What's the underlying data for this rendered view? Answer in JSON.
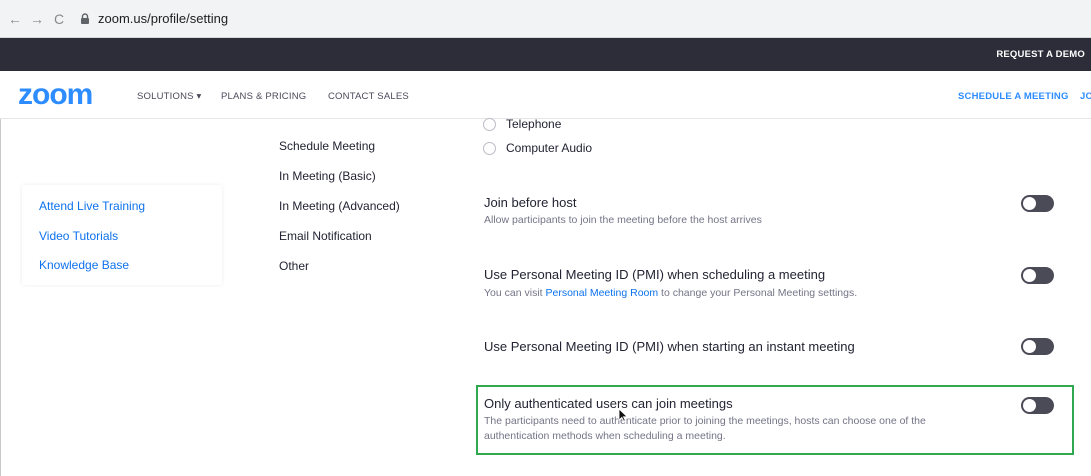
{
  "browser": {
    "back_glyph": "←",
    "forward_glyph": "→",
    "reload_glyph": "C",
    "url": "zoom.us/profile/setting"
  },
  "top_strip": {
    "request_demo": "REQUEST A DEMO"
  },
  "nav": {
    "logo": "zoom",
    "solutions": "SOLUTIONS ▾",
    "plans": "PLANS & PRICING",
    "contact": "CONTACT SALES",
    "schedule": "SCHEDULE A MEETING",
    "join": "JO"
  },
  "support": {
    "items": [
      "Attend Live Training",
      "Video Tutorials",
      "Knowledge Base"
    ]
  },
  "menu": {
    "items": [
      "Schedule Meeting",
      "In Meeting (Basic)",
      "In Meeting (Advanced)",
      "Email Notification",
      "Other"
    ]
  },
  "audio": {
    "options": [
      "Telephone",
      "Computer Audio"
    ]
  },
  "settings": [
    {
      "title": "Join before host",
      "desc": "Allow participants to join the meeting before the host arrives",
      "enabled": false
    },
    {
      "title": "Use Personal Meeting ID (PMI) when scheduling a meeting",
      "desc_prefix": "You can visit ",
      "desc_link": "Personal Meeting Room",
      "desc_suffix": " to change your Personal Meeting settings.",
      "enabled": false
    },
    {
      "title": "Use Personal Meeting ID (PMI) when starting an instant meeting",
      "enabled": false
    },
    {
      "title": "Only authenticated users can join meetings",
      "desc_line1": "The participants need to authenticate prior to joining the meetings, hosts can choose one of the",
      "desc_line2": "authentication methods when scheduling a meeting.",
      "enabled": false
    }
  ],
  "colors": {
    "brand": "#2d8cff",
    "link": "#0e72ed",
    "highlight": "#2fa84f",
    "toggle_off": "#4b4b57"
  }
}
